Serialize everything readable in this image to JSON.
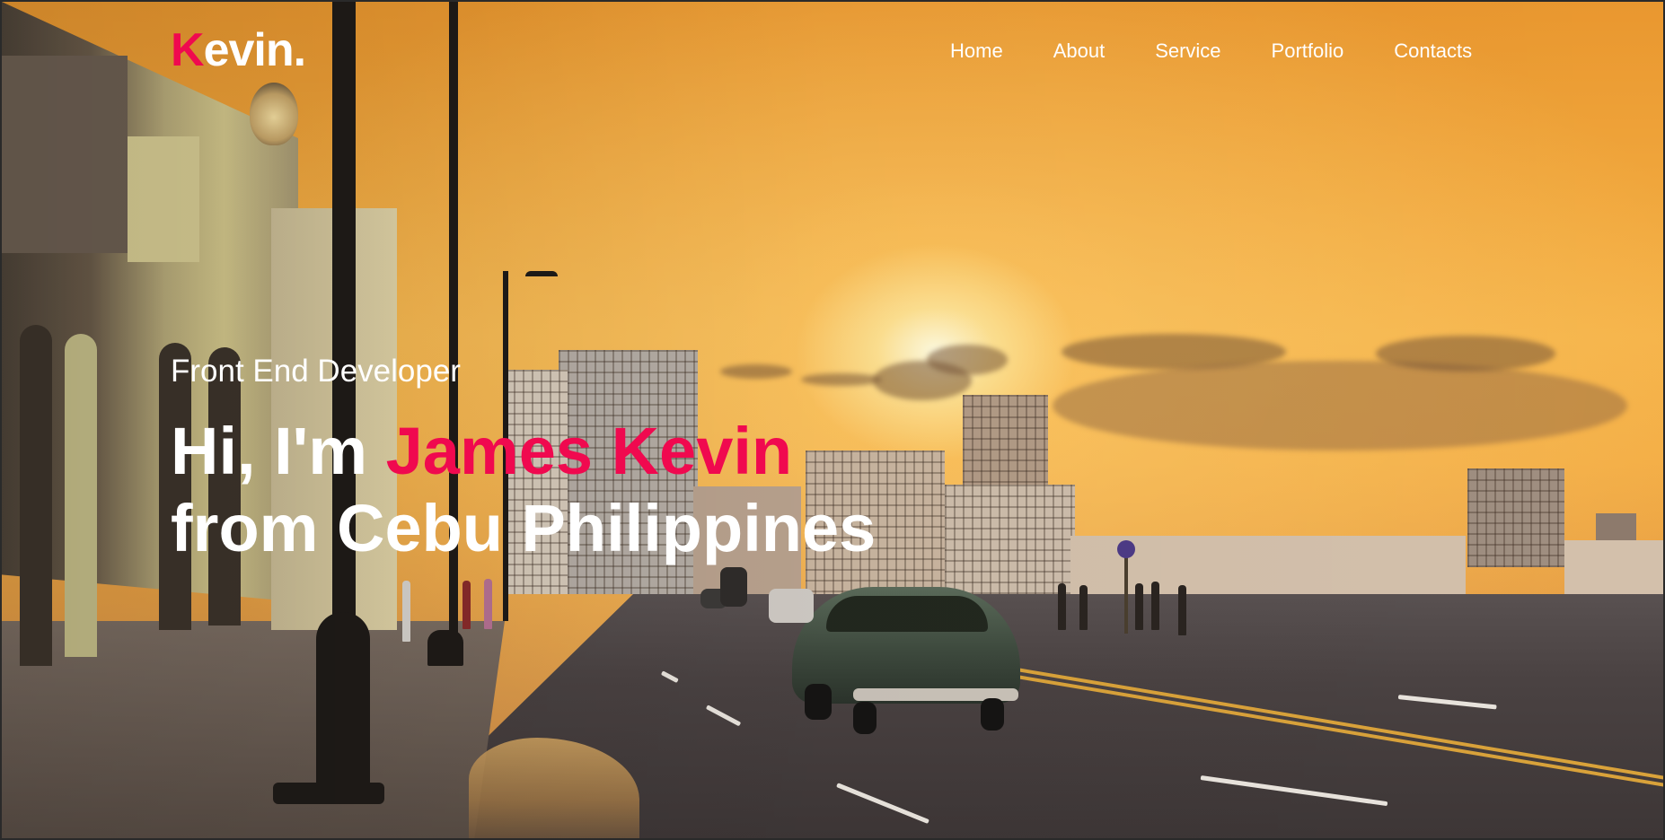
{
  "logo": {
    "first_letter": "K",
    "rest": "evin."
  },
  "nav": {
    "items": [
      {
        "label": "Home"
      },
      {
        "label": "About"
      },
      {
        "label": "Service"
      },
      {
        "label": "Portfolio"
      },
      {
        "label": "Contacts"
      }
    ]
  },
  "hero": {
    "role": "Front End Developer",
    "greeting": "Hi, I'm ",
    "name": "James Kevin",
    "location": "from Cebu Philippines"
  },
  "colors": {
    "accent": "#f0094f",
    "text": "#ffffff"
  }
}
